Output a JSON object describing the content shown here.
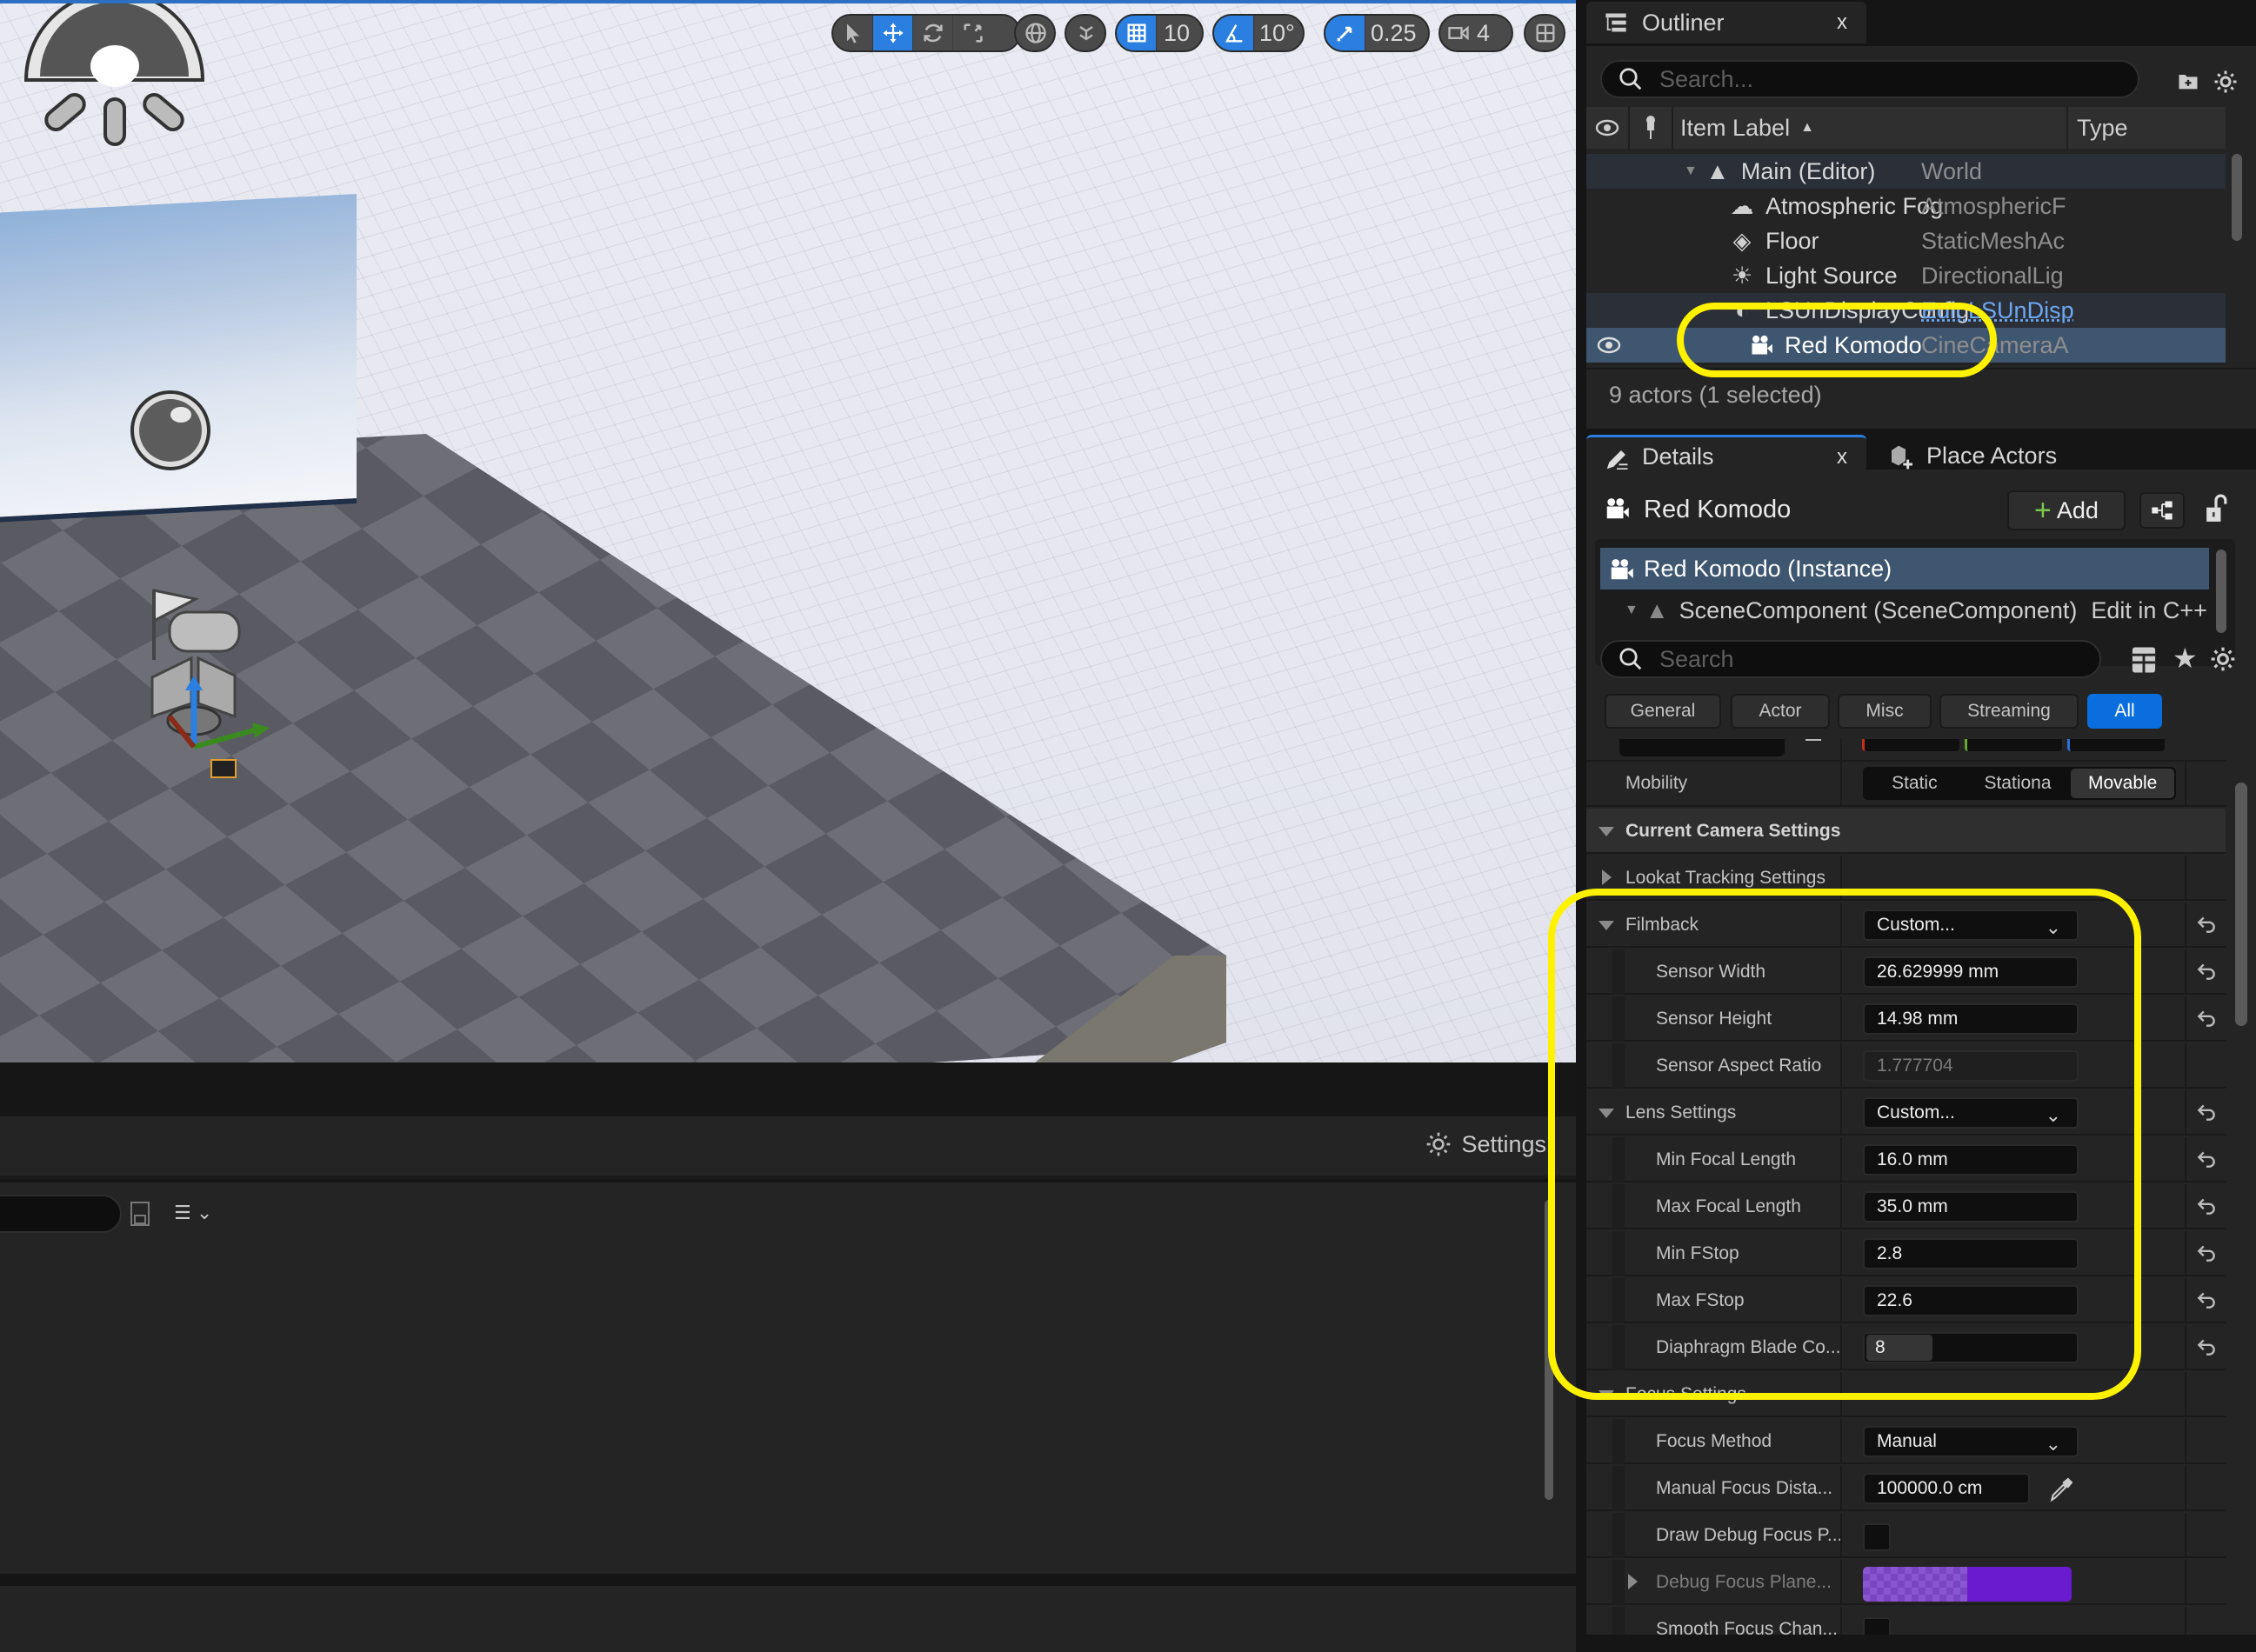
{
  "viewport": {
    "toolbar": {
      "transform_tools": [
        "select-mode",
        "translate-mode",
        "rotate-mode",
        "scale-mode"
      ],
      "active_tool": "translate-mode",
      "grid_snap_value": "10",
      "rotation_snap_value": "10°",
      "scale_snap_value": "0.25",
      "camera_speed_value": "4"
    }
  },
  "bottom_panel": {
    "settings_label": "Settings"
  },
  "outliner": {
    "tab_label": "Outliner",
    "close_label": "x",
    "search_placeholder": "Search...",
    "columns": {
      "item_label": "Item Label",
      "type": "Type"
    },
    "rows": [
      {
        "label": "Main (Editor)",
        "type": "World",
        "icon": "world-icon"
      },
      {
        "label": "Atmospheric Fog",
        "type": "AtmosphericF",
        "icon": "fog-icon"
      },
      {
        "label": "Floor",
        "type": "StaticMeshAc",
        "icon": "static-mesh-icon"
      },
      {
        "label": "Light Source",
        "type": "DirectionalLig",
        "icon": "directional-light-icon"
      },
      {
        "label": "LSUnDisplayConfig",
        "type": "Edit LSUnDisp",
        "icon": "display-config-icon"
      },
      {
        "label": "Red Komodo",
        "type": "CineCameraA",
        "icon": "cine-camera-icon",
        "selected": true
      }
    ],
    "status": "9 actors (1 selected)"
  },
  "details": {
    "tab_label": "Details",
    "close_label": "x",
    "place_actors_label": "Place Actors",
    "actor_name": "Red Komodo",
    "add_label": "Add",
    "components": [
      {
        "label": "Red Komodo (Instance)",
        "selected": true
      },
      {
        "label": "SceneComponent (SceneComponent)",
        "action": "Edit in C++"
      }
    ],
    "search_placeholder": "Search",
    "categories": [
      "General",
      "Actor",
      "Misc",
      "Streaming",
      "All"
    ],
    "active_category": "All",
    "mobility": {
      "label": "Mobility",
      "options": [
        "Static",
        "Stationa",
        "Movable"
      ],
      "selected": "Movable"
    },
    "sections": {
      "current_camera": "Current Camera Settings",
      "lookat": "Lookat Tracking Settings",
      "focus": "Focus Settings"
    },
    "filmback": {
      "label": "Filmback",
      "preset": "Custom...",
      "sensor_width_label": "Sensor Width",
      "sensor_width": "26.629999 mm",
      "sensor_height_label": "Sensor Height",
      "sensor_height": "14.98 mm",
      "aspect_label": "Sensor Aspect Ratio",
      "aspect": "1.777704"
    },
    "lens": {
      "label": "Lens Settings",
      "preset": "Custom...",
      "min_focal_label": "Min Focal Length",
      "min_focal": "16.0 mm",
      "max_focal_label": "Max Focal Length",
      "max_focal": "35.0 mm",
      "min_fstop_label": "Min FStop",
      "min_fstop": "2.8",
      "max_fstop_label": "Max FStop",
      "max_fstop": "22.6",
      "blade_label": "Diaphragm Blade Co...",
      "blade_count": "8"
    },
    "focus": {
      "method_label": "Focus Method",
      "method": "Manual",
      "distance_label": "Manual Focus Dista...",
      "distance": "100000.0 cm",
      "draw_debug_label": "Draw Debug Focus P...",
      "draw_debug": false,
      "debug_color_label": "Debug Focus Plane...",
      "debug_color": "#6a1bd0",
      "smooth_label": "Smooth Focus Chan...",
      "smooth": false
    }
  },
  "colors": {
    "accent": "#0a6ede",
    "highlight": "#fff200",
    "selection": "#3f5671"
  }
}
